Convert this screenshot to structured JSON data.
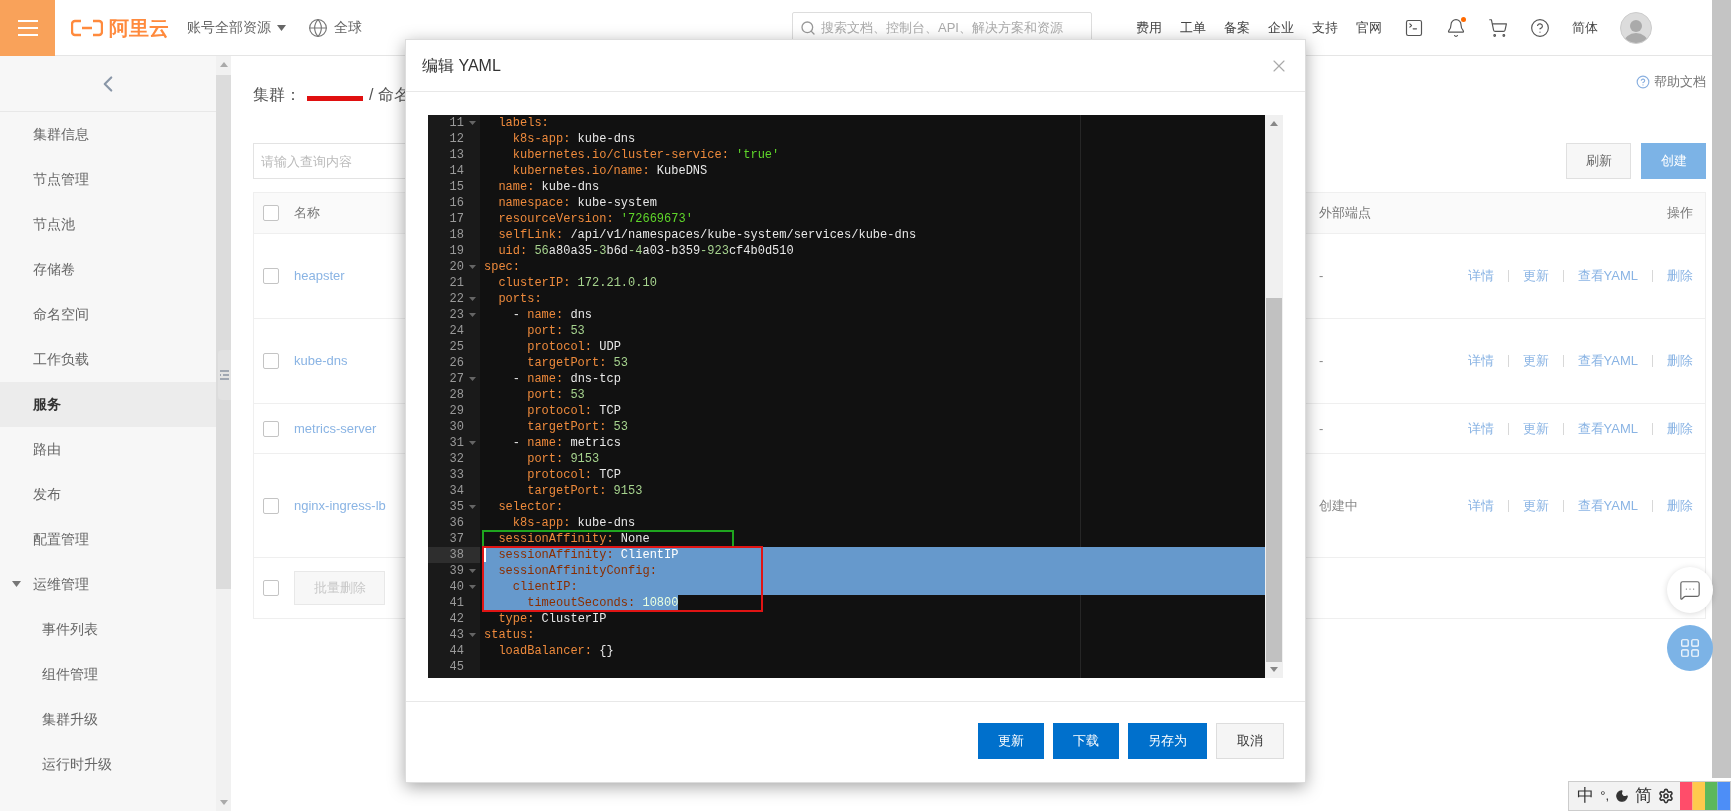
{
  "top_bar": {
    "logo": "阿里云",
    "account_menu": "账号全部资源",
    "region": "全球",
    "search": {
      "placeholder": "搜索文档、控制台、API、解决方案和资源"
    },
    "nav": [
      "费用",
      "工单",
      "备案",
      "企业",
      "支持",
      "官网"
    ],
    "notifications": {
      "unread": true
    },
    "language": "简体"
  },
  "sidebar": {
    "items": [
      {
        "label": "集群信息",
        "selected": false
      },
      {
        "label": "节点管理",
        "selected": false
      },
      {
        "label": "节点池",
        "selected": false
      },
      {
        "label": "存储卷",
        "selected": false
      },
      {
        "label": "命名空间",
        "selected": false
      },
      {
        "label": "工作负载",
        "selected": false
      },
      {
        "label": "服务",
        "selected": true
      },
      {
        "label": "路由",
        "selected": false
      },
      {
        "label": "发布",
        "selected": false
      },
      {
        "label": "配置管理",
        "selected": false
      },
      {
        "label": "运维管理",
        "selected": false,
        "expanded": true,
        "children": [
          {
            "label": "事件列表",
            "selected": false
          },
          {
            "label": "组件管理",
            "selected": false
          },
          {
            "label": "集群升级",
            "selected": false
          },
          {
            "label": "运行时升级",
            "selected": false
          }
        ]
      }
    ]
  },
  "breadcrumb": {
    "label": "集群：",
    "current": "/ 命名"
  },
  "help_link": "帮助文档",
  "search": {
    "placeholder": "请输入查询内容"
  },
  "toolbar_buttons": [
    {
      "label": "刷新",
      "kind": "default"
    },
    {
      "label": "创建",
      "kind": "primary"
    }
  ],
  "table": {
    "name_header": "名称",
    "endpoint_header": "外部端点",
    "actions_header": "操作",
    "header_checked": false,
    "rows": [
      {
        "checked": false,
        "name": "heapster",
        "endpoint": "-",
        "actions": [
          "详情",
          "更新",
          "查看YAML",
          "删除"
        ]
      },
      {
        "checked": false,
        "name": "kube-dns",
        "endpoint": "-",
        "actions": [
          "详情",
          "更新",
          "查看YAML",
          "删除"
        ]
      },
      {
        "checked": false,
        "name": "metrics-server",
        "endpoint": "-",
        "actions": [
          "详情",
          "更新",
          "查看YAML",
          "删除"
        ]
      },
      {
        "checked": false,
        "name": "nginx-ingress-lb",
        "endpoint": "创建中",
        "actions": [
          "详情",
          "更新",
          "查看YAML",
          "删除"
        ]
      }
    ],
    "footer": {
      "checked": false,
      "bulk_delete": {
        "label": "批量删除",
        "disabled": true
      }
    }
  },
  "dialog": {
    "title": "编辑 YAML",
    "editor": {
      "lines": [
        {
          "number": "11",
          "foldable": true,
          "tokens": [
            {
              "text": "  labels:",
              "kind": "key"
            }
          ]
        },
        {
          "number": "12",
          "foldable": false,
          "tokens": [
            {
              "text": "    k8s-app:",
              "kind": "key"
            },
            {
              "text": " kube-dns",
              "kind": "value"
            }
          ]
        },
        {
          "number": "13",
          "foldable": false,
          "tokens": [
            {
              "text": "    kubernetes.io/cluster-service:",
              "kind": "key"
            },
            {
              "text": " 'true'",
              "kind": "string"
            }
          ]
        },
        {
          "number": "14",
          "foldable": false,
          "tokens": [
            {
              "text": "    kubernetes.io/name:",
              "kind": "key"
            },
            {
              "text": " KubeDNS",
              "kind": "value"
            }
          ]
        },
        {
          "number": "15",
          "foldable": false,
          "tokens": [
            {
              "text": "  name:",
              "kind": "key"
            },
            {
              "text": " kube-dns",
              "kind": "value"
            }
          ]
        },
        {
          "number": "16",
          "foldable": false,
          "tokens": [
            {
              "text": "  namespace:",
              "kind": "key"
            },
            {
              "text": " kube-system",
              "kind": "value"
            }
          ]
        },
        {
          "number": "17",
          "foldable": false,
          "tokens": [
            {
              "text": "  resourceVersion:",
              "kind": "key"
            },
            {
              "text": " '72669673'",
              "kind": "string"
            }
          ]
        },
        {
          "number": "18",
          "foldable": false,
          "tokens": [
            {
              "text": "  selfLink:",
              "kind": "key"
            },
            {
              "text": " /api/v1/namespaces/kube-system/services/kube-dns",
              "kind": "value"
            }
          ]
        },
        {
          "number": "19",
          "foldable": false,
          "tokens": [
            {
              "text": "  uid:",
              "kind": "key"
            },
            {
              "text": " 56",
              "kind": "number"
            },
            {
              "text": "a80a35",
              "kind": "value"
            },
            {
              "text": "-3",
              "kind": "number"
            },
            {
              "text": "b6d",
              "kind": "value"
            },
            {
              "text": "-4",
              "kind": "number"
            },
            {
              "text": "a03-b359",
              "kind": "value"
            },
            {
              "text": "-923",
              "kind": "number"
            },
            {
              "text": "cf4b0d510",
              "kind": "value"
            }
          ]
        },
        {
          "number": "20",
          "foldable": true,
          "tokens": [
            {
              "text": "spec:",
              "kind": "key"
            }
          ]
        },
        {
          "number": "21",
          "foldable": false,
          "tokens": [
            {
              "text": "  clusterIP:",
              "kind": "key"
            },
            {
              "text": " 172.21.0.10",
              "kind": "number"
            }
          ]
        },
        {
          "number": "22",
          "foldable": true,
          "tokens": [
            {
              "text": "  ports:",
              "kind": "key"
            }
          ]
        },
        {
          "number": "23",
          "foldable": true,
          "tokens": [
            {
              "text": "    - ",
              "kind": "value"
            },
            {
              "text": "name:",
              "kind": "key"
            },
            {
              "text": " dns",
              "kind": "value"
            }
          ]
        },
        {
          "number": "24",
          "foldable": false,
          "tokens": [
            {
              "text": "      port:",
              "kind": "key"
            },
            {
              "text": " 53",
              "kind": "number"
            }
          ]
        },
        {
          "number": "25",
          "foldable": false,
          "tokens": [
            {
              "text": "      protocol:",
              "kind": "key"
            },
            {
              "text": " UDP",
              "kind": "value"
            }
          ]
        },
        {
          "number": "26",
          "foldable": false,
          "tokens": [
            {
              "text": "      targetPort:",
              "kind": "key"
            },
            {
              "text": " 53",
              "kind": "number"
            }
          ]
        },
        {
          "number": "27",
          "foldable": true,
          "tokens": [
            {
              "text": "    - ",
              "kind": "value"
            },
            {
              "text": "name:",
              "kind": "key"
            },
            {
              "text": " dns-tcp",
              "kind": "value"
            }
          ]
        },
        {
          "number": "28",
          "foldable": false,
          "tokens": [
            {
              "text": "      port:",
              "kind": "key"
            },
            {
              "text": " 53",
              "kind": "number"
            }
          ]
        },
        {
          "number": "29",
          "foldable": false,
          "tokens": [
            {
              "text": "      protocol:",
              "kind": "key"
            },
            {
              "text": " TCP",
              "kind": "value"
            }
          ]
        },
        {
          "number": "30",
          "foldable": false,
          "tokens": [
            {
              "text": "      targetPort:",
              "kind": "key"
            },
            {
              "text": " 53",
              "kind": "number"
            }
          ]
        },
        {
          "number": "31",
          "foldable": true,
          "tokens": [
            {
              "text": "    - ",
              "kind": "value"
            },
            {
              "text": "name:",
              "kind": "key"
            },
            {
              "text": " metrics",
              "kind": "value"
            }
          ]
        },
        {
          "number": "32",
          "foldable": false,
          "tokens": [
            {
              "text": "      port:",
              "kind": "key"
            },
            {
              "text": " 9153",
              "kind": "number"
            }
          ]
        },
        {
          "number": "33",
          "foldable": false,
          "tokens": [
            {
              "text": "      protocol:",
              "kind": "key"
            },
            {
              "text": " TCP",
              "kind": "value"
            }
          ]
        },
        {
          "number": "34",
          "foldable": false,
          "tokens": [
            {
              "text": "      targetPort:",
              "kind": "key"
            },
            {
              "text": " 9153",
              "kind": "number"
            }
          ]
        },
        {
          "number": "35",
          "foldable": true,
          "tokens": [
            {
              "text": "  selector:",
              "kind": "key"
            }
          ]
        },
        {
          "number": "36",
          "foldable": false,
          "tokens": [
            {
              "text": "    k8s-app:",
              "kind": "key"
            },
            {
              "text": " kube-dns",
              "kind": "value"
            }
          ]
        },
        {
          "number": "37",
          "foldable": false,
          "color": "#1fa51f",
          "tokens": [
            {
              "text": "  sessionAffinity:",
              "kind": "key"
            },
            {
              "text": " None",
              "kind": "value"
            }
          ]
        },
        {
          "number": "38",
          "foldable": false,
          "selected": true,
          "cursor": true,
          "color": "#e01414",
          "tokens": [
            {
              "text": "  sessionAffinity:",
              "kind": "key"
            },
            {
              "text": " ClientIP",
              "kind": "value"
            }
          ]
        },
        {
          "number": "39",
          "foldable": true,
          "selected": true,
          "color": "#e01414",
          "tokens": [
            {
              "text": "  sessionAffinityConfig:",
              "kind": "key"
            }
          ]
        },
        {
          "number": "40",
          "foldable": true,
          "selected": true,
          "color": "#e01414",
          "tokens": [
            {
              "text": "    clientIP:",
              "kind": "key"
            }
          ]
        },
        {
          "number": "41",
          "foldable": false,
          "selected": true,
          "color": "#e01414",
          "tokens": [
            {
              "text": "      timeoutSeconds:",
              "kind": "key"
            },
            {
              "text": " 10800",
              "kind": "number"
            }
          ]
        },
        {
          "number": "42",
          "foldable": false,
          "tokens": [
            {
              "text": "  type:",
              "kind": "key"
            },
            {
              "text": " ClusterIP",
              "kind": "value"
            }
          ]
        },
        {
          "number": "43",
          "foldable": true,
          "tokens": [
            {
              "text": "status:",
              "kind": "key"
            }
          ]
        },
        {
          "number": "44",
          "foldable": false,
          "tokens": [
            {
              "text": "  loadBalancer:",
              "kind": "key"
            },
            {
              "text": " {}",
              "kind": "value"
            }
          ]
        },
        {
          "number": "45",
          "foldable": false
        }
      ]
    },
    "buttons": [
      {
        "label": "更新",
        "kind": "primary"
      },
      {
        "label": "下载",
        "kind": "primary"
      },
      {
        "label": "另存为",
        "kind": "primary"
      },
      {
        "label": "取消",
        "kind": "default"
      }
    ]
  },
  "ime_bar": {
    "mode": "中",
    "punctuation": "°,",
    "script": "简"
  }
}
